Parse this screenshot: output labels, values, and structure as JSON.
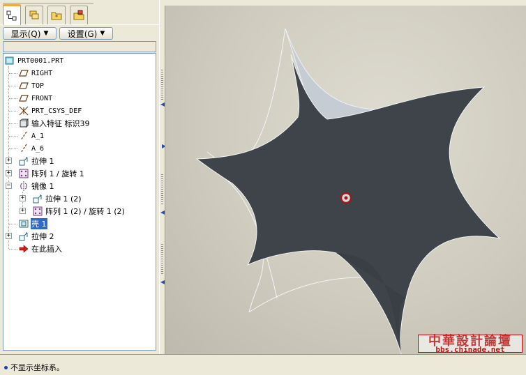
{
  "toolbar": {
    "show_menu": "显示(Q)",
    "settings_menu": "设置(G)"
  },
  "model_tree": {
    "items": [
      {
        "label": "PRT0001.PRT",
        "icon": "part-icon"
      },
      {
        "label": "RIGHT",
        "icon": "datum-plane-icon"
      },
      {
        "label": "TOP",
        "icon": "datum-plane-icon"
      },
      {
        "label": "FRONT",
        "icon": "datum-plane-icon"
      },
      {
        "label": "PRT_CSYS_DEF",
        "icon": "coordinate-system-icon"
      },
      {
        "label": "输入特征 标识39",
        "icon": "import-feature-icon"
      },
      {
        "label": "A_1",
        "icon": "datum-axis-icon"
      },
      {
        "label": "A_6",
        "icon": "datum-axis-icon"
      },
      {
        "label": "拉伸 1",
        "icon": "extrude-icon"
      },
      {
        "label": "阵列 1 / 旋转 1",
        "icon": "pattern-icon"
      },
      {
        "label": "镜像 1",
        "icon": "mirror-icon"
      },
      {
        "label": "拉伸 1 (2)",
        "icon": "extrude-icon"
      },
      {
        "label": "阵列 1 (2) / 旋转 1 (2)",
        "icon": "pattern-icon"
      },
      {
        "label": "壳 1",
        "icon": "shell-icon"
      },
      {
        "label": "拉伸 2",
        "icon": "extrude-icon"
      },
      {
        "label": "在此插入",
        "icon": "insert-here-arrow-icon"
      }
    ]
  },
  "status": {
    "message": "不显示坐标系。"
  },
  "watermark": {
    "title": "中華設計論壇",
    "url": "bbs.chinade.net"
  },
  "colors": {
    "selection": "#316ac5",
    "surface_dark": "#3f434a",
    "surface_light": "#c3cad3",
    "insert_arrow": "#d21a1a"
  }
}
